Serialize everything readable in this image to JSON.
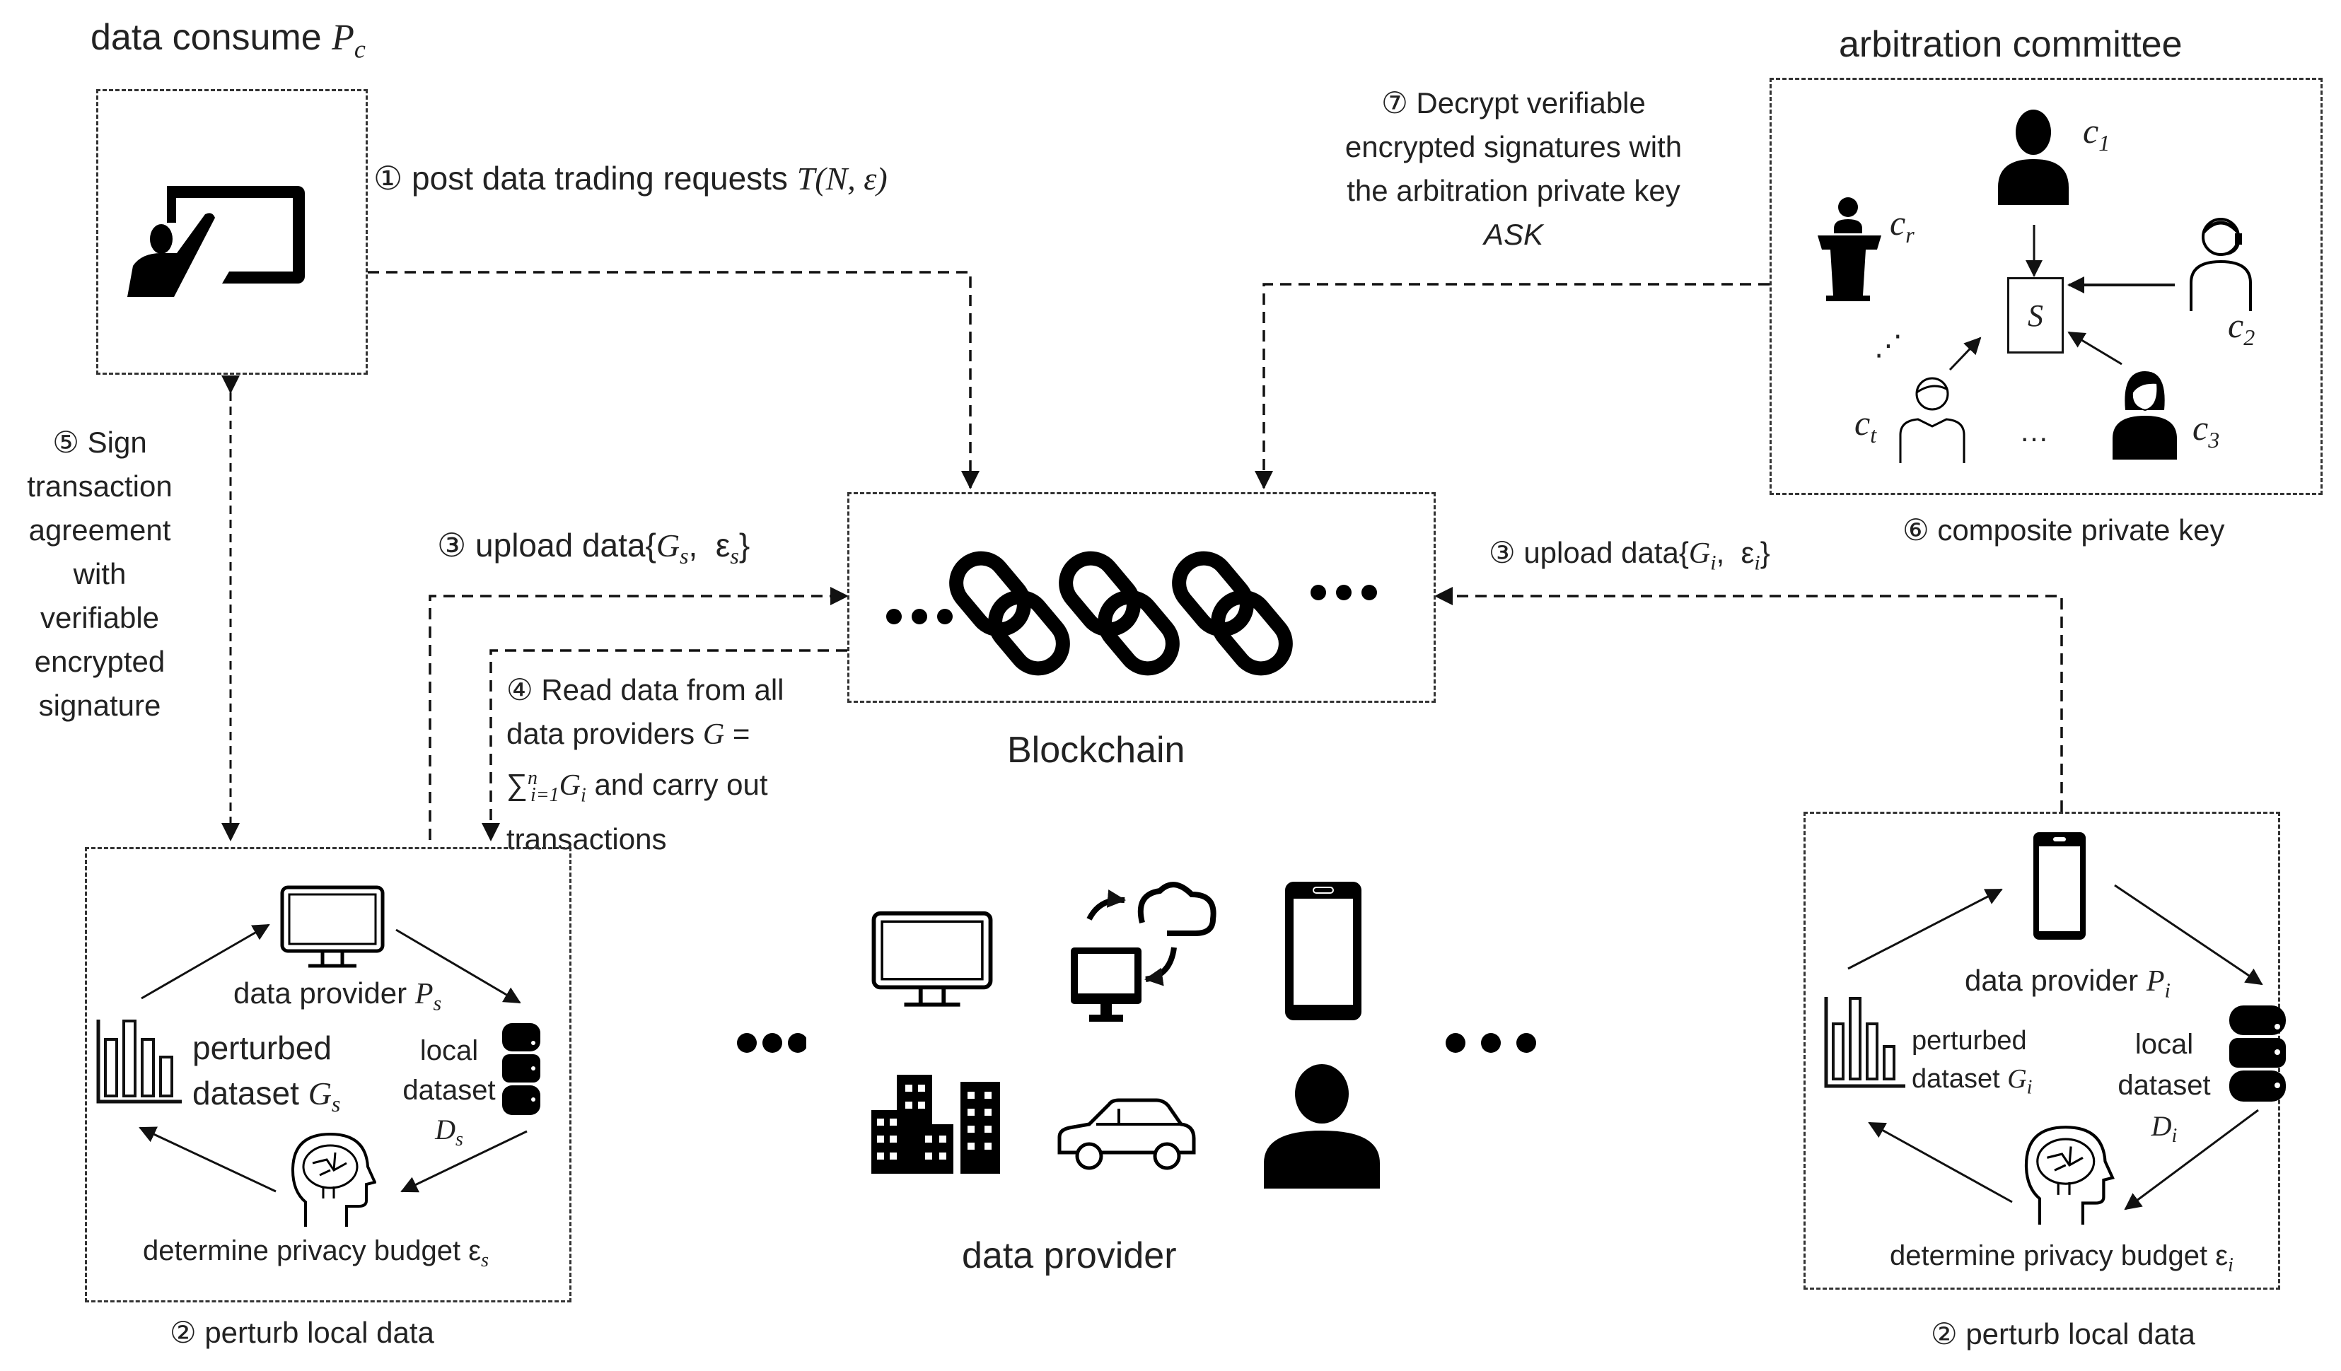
{
  "consumer": {
    "title": "data consume",
    "title_symbol": "P",
    "title_sub": "c",
    "icon": "presenter-board-icon"
  },
  "arbitration": {
    "title": "arbitration committee",
    "center_label": "S",
    "members": [
      {
        "label": "c",
        "sub": "1",
        "icon": "person-icon"
      },
      {
        "label": "c",
        "sub": "2",
        "icon": "headset-person-icon"
      },
      {
        "label": "c",
        "sub": "3",
        "icon": "woman-icon"
      },
      {
        "label": "c",
        "sub": "t",
        "icon": "man-outline-icon"
      },
      {
        "label": "c",
        "sub": "r",
        "icon": "podium-speaker-icon"
      }
    ],
    "ellipsis_bottom": "…",
    "ellipsis_left": "⋰"
  },
  "steps": {
    "step1": {
      "num": "①",
      "text": "post data trading requests",
      "formula": "T(N, ε)"
    },
    "step3_left": {
      "num": "③",
      "text": "upload data{",
      "g": "G",
      "g_sub": "s",
      "sep": ",  ",
      "eps": "ε",
      "eps_sub": "s",
      "close": "}"
    },
    "step3_right": {
      "num": "③",
      "text": "upload data{",
      "g": "G",
      "g_sub": "i",
      "sep": ",  ",
      "eps": "ε",
      "eps_sub": "i",
      "close": "}"
    },
    "step4": {
      "num": "④",
      "lines": [
        "Read data from all",
        "data providers",
        "and carry out",
        "transactions"
      ],
      "g": "G",
      "eq": " =",
      "sum": "∑",
      "sum_sup": "n",
      "sum_sub": "i=1",
      "gi": "G",
      "gi_sub": "i"
    },
    "step5": {
      "num": "⑤",
      "lines": [
        "Sign",
        "transaction",
        "agreement",
        "with",
        "verifiable",
        "encrypted",
        "signature"
      ]
    },
    "step6": {
      "num": "⑥",
      "text": "composite private key"
    },
    "step7": {
      "num": "⑦",
      "lines": [
        "Decrypt verifiable",
        "encrypted signatures with",
        "the arbitration private key"
      ],
      "key": "ASK"
    }
  },
  "blockchain": {
    "label": "Blockchain",
    "icon": "chain-links-icon",
    "dots": "•••"
  },
  "provider_left": {
    "device_icon": "monitor-icon",
    "provider_label": "data provider",
    "provider_sym": "P",
    "provider_sub": "s",
    "perturbed_line1": "perturbed",
    "perturbed_line2": "dataset",
    "perturbed_sym": "G",
    "perturbed_sub": "s",
    "local_line1": "local",
    "local_line2": "dataset",
    "local_sym": "D",
    "local_sub": "s",
    "budget_label": "determine privacy budget",
    "budget_sym": "ε",
    "budget_sub": "s",
    "caption_num": "②",
    "caption": "perturb local data"
  },
  "provider_right": {
    "device_icon": "smartphone-icon",
    "provider_label": "data provider",
    "provider_sym": "P",
    "provider_sub": "i",
    "perturbed_line1": "perturbed",
    "perturbed_line2": "dataset",
    "perturbed_sym": "G",
    "perturbed_sub": "i",
    "local_line1": "local",
    "local_line2": "dataset",
    "local_sym": "D",
    "local_sub": "i",
    "budget_label": "determine privacy budget",
    "budget_sym": "ε",
    "budget_sub": "i",
    "caption_num": "②",
    "caption": "perturb local data"
  },
  "data_provider_group": {
    "label": "data provider",
    "icons": [
      "monitor-icon",
      "computer-cloud-sync-icon",
      "smartphone-icon",
      "city-buildings-icon",
      "car-icon",
      "person-icon"
    ],
    "dots": "•••"
  }
}
